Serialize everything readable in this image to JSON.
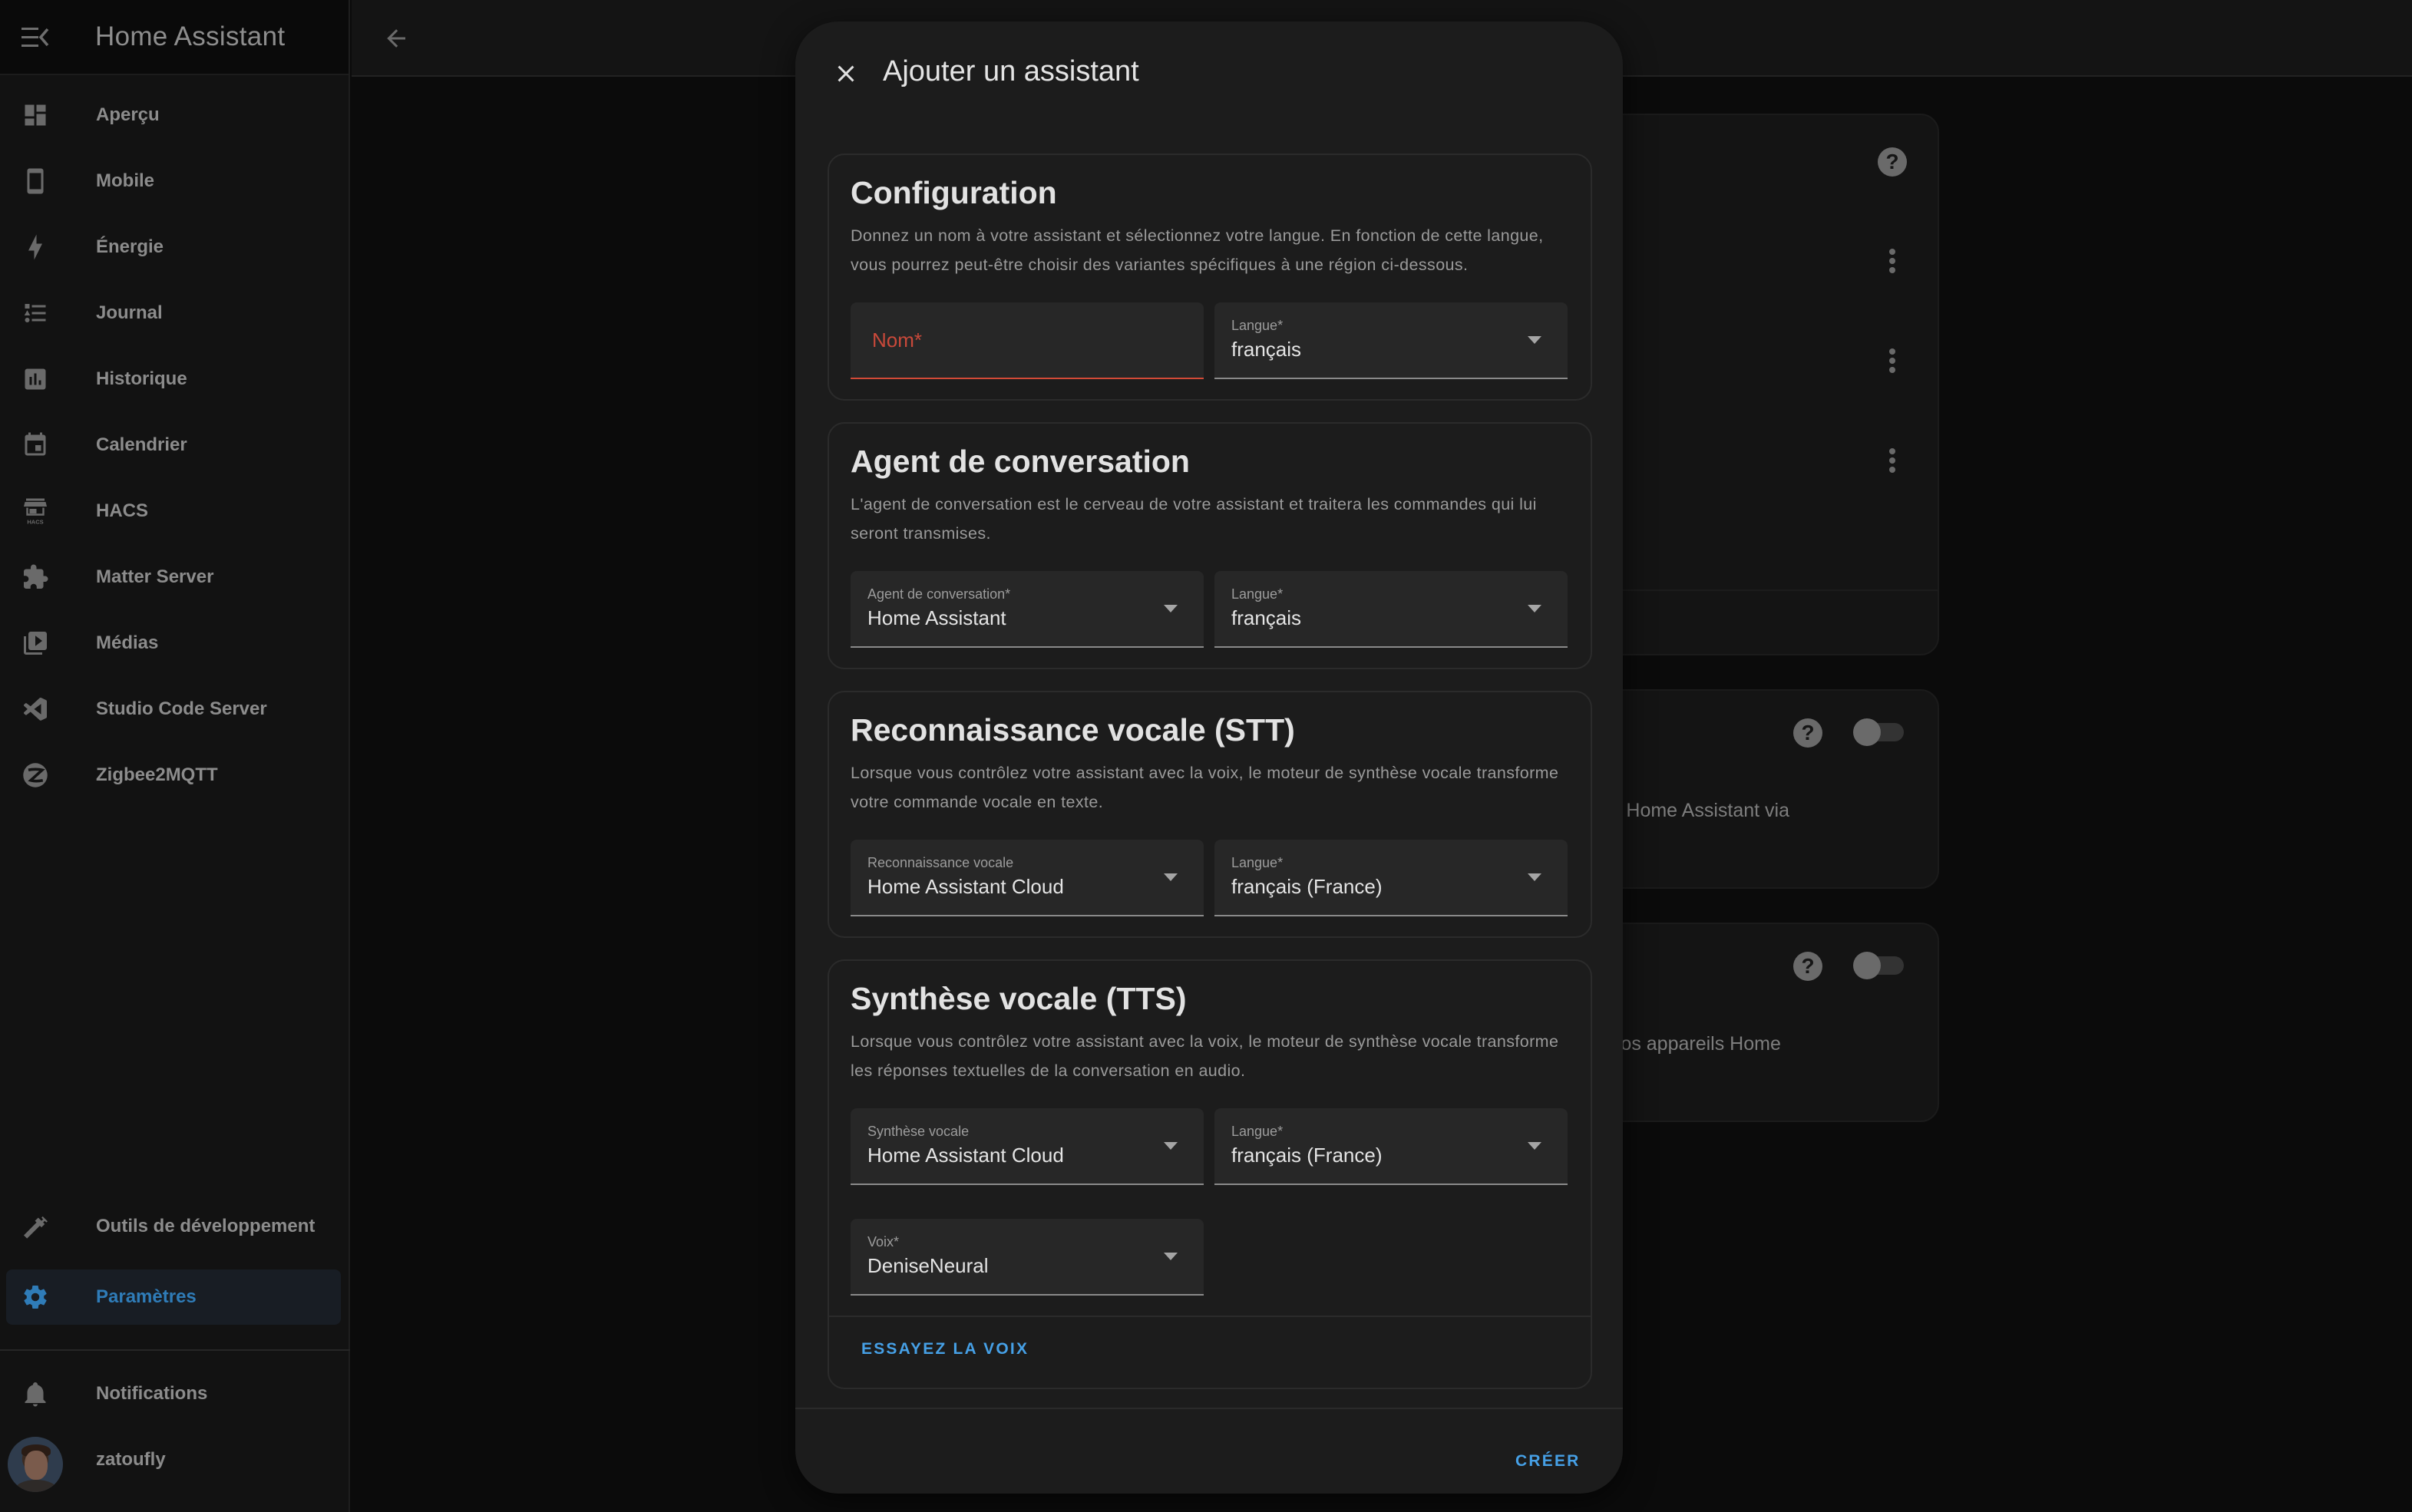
{
  "sidebar": {
    "title": "Home Assistant",
    "items": [
      {
        "label": "Aperçu",
        "icon": "dashboard-icon"
      },
      {
        "label": "Mobile",
        "icon": "cellphone-icon"
      },
      {
        "label": "Énergie",
        "icon": "lightning-bolt-icon"
      },
      {
        "label": "Journal",
        "icon": "format-list-bulleted-type-icon"
      },
      {
        "label": "Historique",
        "icon": "chart-box-icon"
      },
      {
        "label": "Calendrier",
        "icon": "calendar-icon"
      },
      {
        "label": "HACS",
        "icon": "hacs-store-icon"
      },
      {
        "label": "Matter Server",
        "icon": "puzzle-icon"
      },
      {
        "label": "Médias",
        "icon": "play-box-multiple-icon"
      },
      {
        "label": "Studio Code Server",
        "icon": "vscode-icon"
      },
      {
        "label": "Zigbee2MQTT",
        "icon": "zigbee-icon"
      }
    ],
    "bottom_items": [
      {
        "label": "Outils de développement",
        "icon": "hammer-icon"
      },
      {
        "label": "Paramètres",
        "icon": "cog-icon",
        "active": true
      }
    ],
    "notifications_label": "Notifications",
    "user_name": "zatoufly",
    "hacs_icon_text": "HACS"
  },
  "background": {
    "card2_text": "appareils Home Assistant via",
    "card3_text": "ler tous vos appareils Home",
    "help_glyph": "?"
  },
  "dialog": {
    "title": "Ajouter un assistant",
    "sections": {
      "configuration": {
        "title": "Configuration",
        "description": "Donnez un nom à votre assistant et sélectionnez votre langue. En fonction de cette langue, vous pourrez peut-être choisir des variantes spécifiques à une région ci-dessous.",
        "name_field": {
          "placeholder": "Nom*",
          "value": ""
        },
        "language_field": {
          "label": "Langue*",
          "value": "français"
        }
      },
      "conversation": {
        "title": "Agent de conversation",
        "description": "L'agent de conversation est le cerveau de votre assistant et traitera les commandes qui lui seront transmises.",
        "agent_field": {
          "label": "Agent de conversation*",
          "value": "Home Assistant"
        },
        "language_field": {
          "label": "Langue*",
          "value": "français"
        }
      },
      "stt": {
        "title": "Reconnaissance vocale (STT)",
        "description": "Lorsque vous contrôlez votre assistant avec la voix, le moteur de synthèse vocale transforme votre commande vocale en texte.",
        "engine_field": {
          "label": "Reconnaissance vocale",
          "value": "Home Assistant Cloud"
        },
        "language_field": {
          "label": "Langue*",
          "value": "français (France)"
        }
      },
      "tts": {
        "title": "Synthèse vocale (TTS)",
        "description": "Lorsque vous contrôlez votre assistant avec la voix, le moteur de synthèse vocale transforme les réponses textuelles de la conversation en audio.",
        "engine_field": {
          "label": "Synthèse vocale",
          "value": "Home Assistant Cloud"
        },
        "language_field": {
          "label": "Langue*",
          "value": "français (France)"
        },
        "voice_field": {
          "label": "Voix*",
          "value": "DeniseNeural"
        },
        "try_voice_label": "ESSAYEZ LA VOIX"
      }
    },
    "create_label": "CRÉER"
  },
  "colors": {
    "accent": "#46a0e6",
    "active_nav": "#2f7cb8",
    "error": "#d24a37",
    "dialog_bg": "#1c1c1c",
    "field_bg": "#272727"
  }
}
